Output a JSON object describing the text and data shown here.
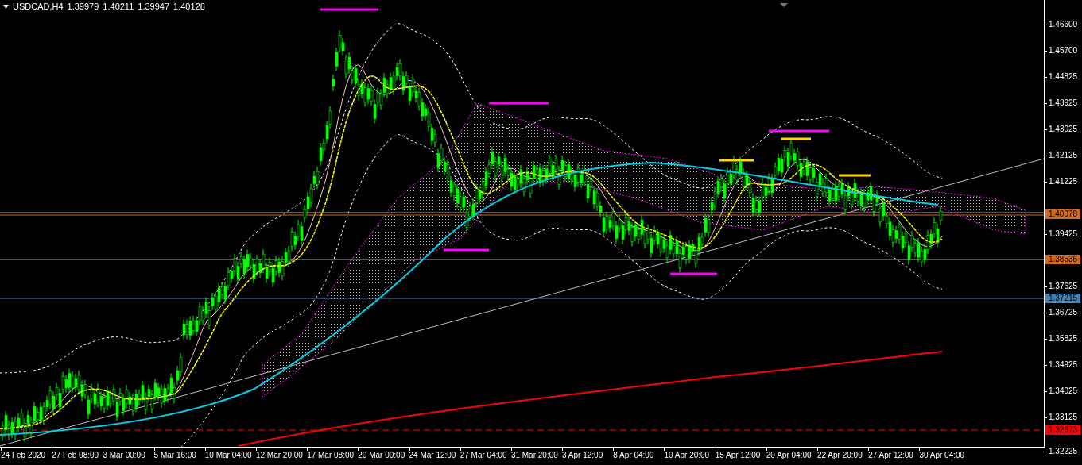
{
  "header": {
    "symbol": "USDCAD,H4",
    "quotes": [
      "1.39979",
      "1.40211",
      "1.39947",
      "1.40128"
    ]
  },
  "price_axis": {
    "ticks": [
      "1.46600",
      "1.45700",
      "1.44825",
      "1.43925",
      "1.43025",
      "1.42125",
      "1.41225",
      "1.39425",
      "1.37625",
      "1.36725",
      "1.35825",
      "1.34925",
      "1.34025",
      "1.33125",
      "1.32225"
    ],
    "tags": [
      {
        "label": "1.40078",
        "color": "#d2691e"
      },
      {
        "label": "1.38536",
        "color": "#d2691e"
      },
      {
        "label": "1.37215",
        "color": "#4682b4"
      },
      {
        "label": "1.32673",
        "color": "#ff0000"
      }
    ]
  },
  "time_axis": {
    "labels": [
      "24 Feb 2020",
      "27 Feb 08:00",
      "3 Mar 00:00",
      "5 Mar 16:00",
      "10 Mar 04:00",
      "12 Mar 20:00",
      "17 Mar 08:00",
      "20 Mar 00:00",
      "24 Mar 12:00",
      "27 Mar 04:00",
      "31 Mar 20:00",
      "3 Apr 12:00",
      "8 Apr 04:00",
      "10 Apr 20:00",
      "15 Apr 12:00",
      "20 Apr 04:00",
      "22 Apr 20:00",
      "27 Apr 12:00",
      "30 Apr 04:00"
    ]
  }
}
